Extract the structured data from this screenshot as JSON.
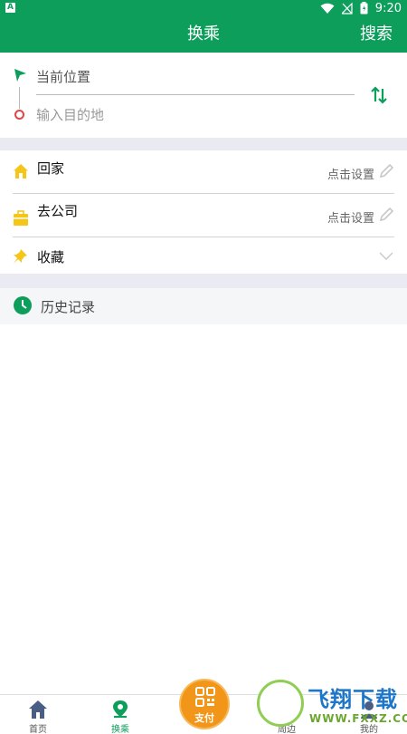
{
  "status_bar": {
    "time": "9:20",
    "notification_badge": "A"
  },
  "header": {
    "title": "换乘",
    "search_label": "搜索"
  },
  "route": {
    "from_text": "当前位置",
    "to_placeholder": "输入目的地"
  },
  "shortcuts": [
    {
      "label": "回家",
      "action": "点击设置",
      "icon": "home-icon"
    },
    {
      "label": "去公司",
      "action": "点击设置",
      "icon": "briefcase-icon"
    },
    {
      "label": "收藏",
      "icon": "pin-icon"
    }
  ],
  "history": {
    "label": "历史记录"
  },
  "nav": {
    "items": [
      {
        "label": "首页",
        "icon": "home-icon"
      },
      {
        "label": "换乘",
        "icon": "transfer-icon",
        "active": true
      },
      {
        "label": "周边",
        "icon": "nearby-icon"
      },
      {
        "label": "我的",
        "icon": "user-icon"
      }
    ],
    "pay_label": "支付"
  },
  "watermark": {
    "brand": "飞翔下载",
    "url": "WWW.FXXZ.COM"
  },
  "colors": {
    "brand_green": "#0d9e5c",
    "pay_orange": "#f2961a",
    "home_yellow": "#f5c518",
    "destination_red": "#e04646"
  }
}
